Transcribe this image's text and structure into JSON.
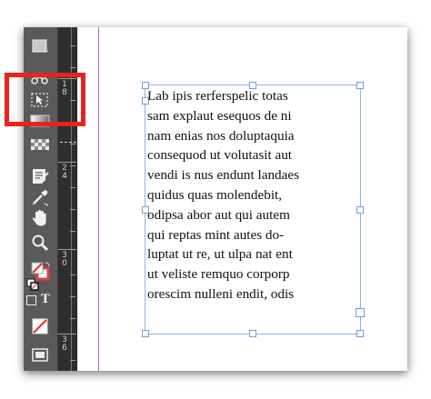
{
  "ruler": {
    "labels": [
      {
        "id": "r18",
        "a": "1",
        "b": "8"
      },
      {
        "id": "r24",
        "a": "2",
        "b": "4"
      },
      {
        "id": "r30",
        "a": "3",
        "b": "0"
      },
      {
        "id": "r36",
        "a": "3",
        "b": "6"
      }
    ]
  },
  "toolbar": {
    "text_tool_glyph": "T"
  },
  "text_frame": {
    "lines": [
      "Lab ipis rerferspelic totas",
      "sam explaut esequos de ni",
      "nam enias nos doluptaquia",
      "consequod ut volutasit aut",
      "vendi is nus endunt landaes",
      "quidus quas molendebit,",
      "odipsa abor aut qui autem",
      "qui reptas mint autes do-",
      "luptat ut re, ut ulpa nat ent",
      "ut veliste remquo corporp",
      "orescim nulleni endit, odis"
    ]
  },
  "colors": {
    "highlight": "#e3251d",
    "frame_border": "#8fb3e3",
    "margin_guide": "#c05ab8",
    "toolbar_bg": "#5a5a5a"
  }
}
